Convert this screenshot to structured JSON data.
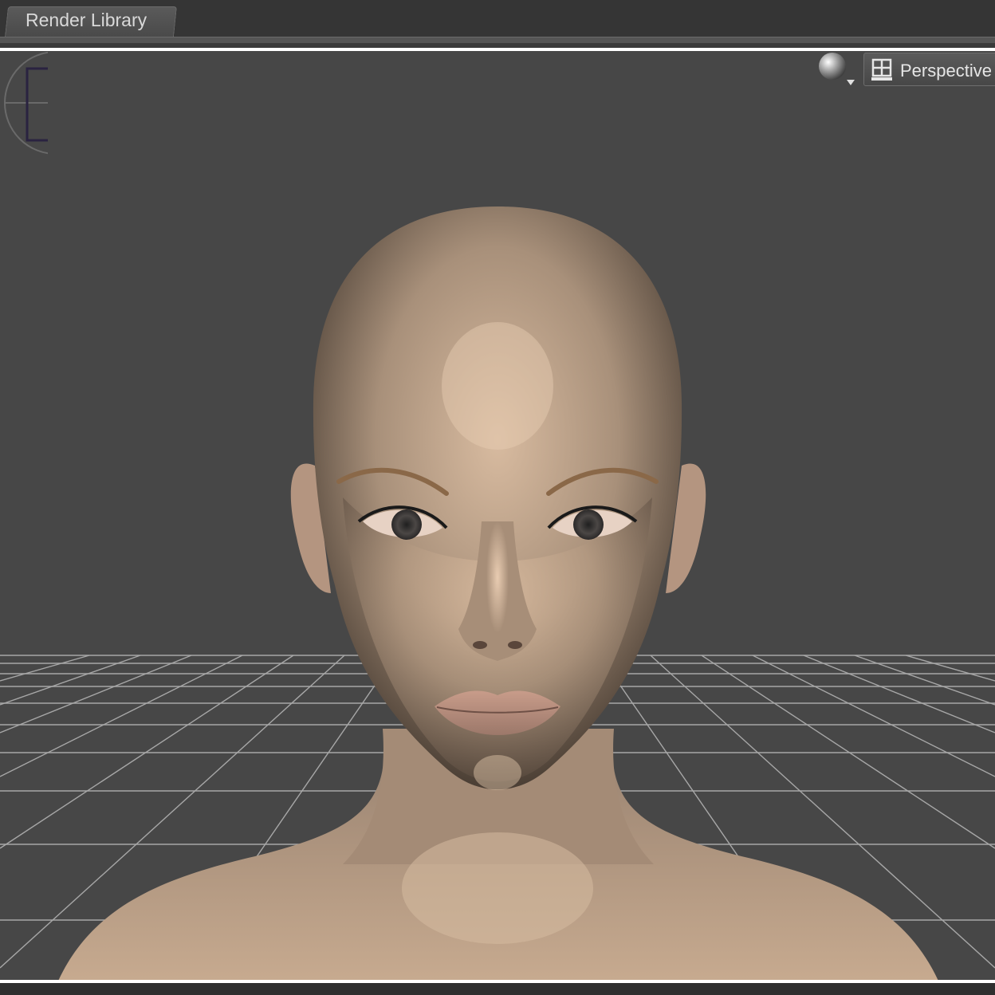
{
  "tabs": [
    {
      "label": "Render Library"
    }
  ],
  "viewport": {
    "camera_label": "Perspective",
    "shading_icon": "sphere-shading-icon",
    "camera_icon": "camera-view-icon",
    "background_color": "#474747",
    "grid_color": "#b8b8b8"
  }
}
